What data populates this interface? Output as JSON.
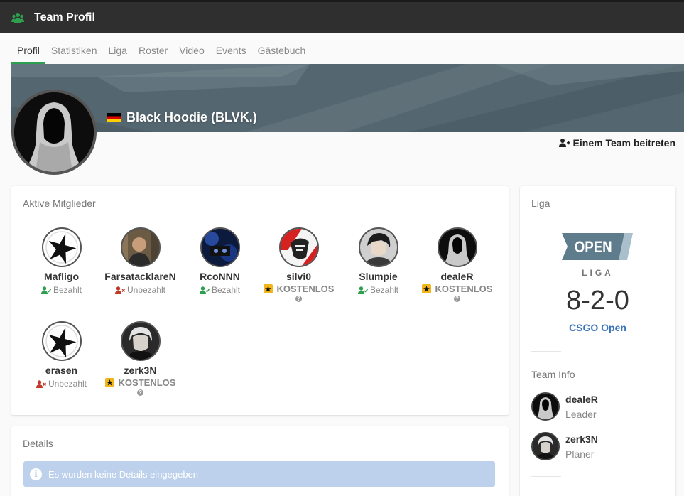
{
  "header": {
    "title": "Team Profil",
    "icon": "users-icon"
  },
  "tabs": [
    {
      "label": "Profil",
      "active": true
    },
    {
      "label": "Statistiken"
    },
    {
      "label": "Liga"
    },
    {
      "label": "Roster"
    },
    {
      "label": "Video"
    },
    {
      "label": "Events"
    },
    {
      "label": "Gästebuch"
    }
  ],
  "team": {
    "name": "Black Hoodie (BLVK.)",
    "flag": "germany-flag-icon"
  },
  "join_label": "Einem Team beitreten",
  "members_card": {
    "title": "Aktive Mitglieder",
    "members": [
      {
        "name": "Mafligo",
        "status": "Bezahlt",
        "status_type": "paid"
      },
      {
        "name": "FarsatacklareN",
        "status": "Unbezahlt",
        "status_type": "unpaid"
      },
      {
        "name": "RcoNNN",
        "status": "Bezahlt",
        "status_type": "paid"
      },
      {
        "name": "silvi0",
        "status": "KOSTENLOS",
        "status_type": "free",
        "help": "?"
      },
      {
        "name": "Slumpie",
        "status": "Bezahlt",
        "status_type": "paid"
      },
      {
        "name": "dealeR",
        "status": "KOSTENLOS",
        "status_type": "free",
        "help": "?"
      },
      {
        "name": "erasen",
        "status": "Unbezahlt",
        "status_type": "unpaid"
      },
      {
        "name": "zerk3N",
        "status": "KOSTENLOS",
        "status_type": "free",
        "help": "?"
      }
    ]
  },
  "details_card": {
    "title": "Details",
    "alert": "Es wurden keine Details eingegeben",
    "alert_icon": "i"
  },
  "liga_card": {
    "title": "Liga",
    "badge": "OPEN",
    "liga_word": "LIGA",
    "record": "8-2-0",
    "liga_name": "CSGO Open",
    "team_info_title": "Team Info",
    "team_info": [
      {
        "name": "dealeR",
        "role": "Leader"
      },
      {
        "name": "zerk3N",
        "role": "Planer"
      }
    ]
  },
  "colors": {
    "accent": "#2e9e4f",
    "paid": "#2e9e4f",
    "unpaid": "#c0392b",
    "link": "#3a74b8",
    "badge": "#5e7c8c"
  }
}
